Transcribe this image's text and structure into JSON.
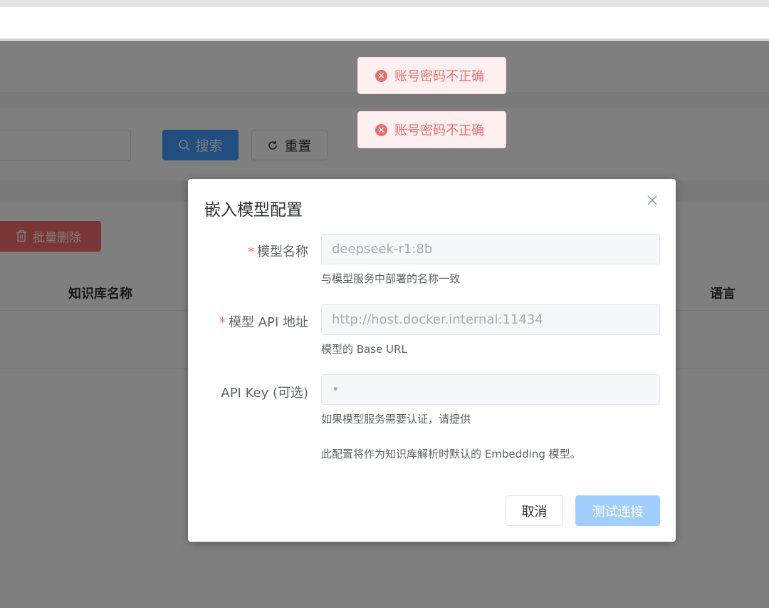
{
  "toolbar": {
    "search_label": "搜索",
    "reset_label": "重置",
    "batch_delete_label": "批量删除"
  },
  "table": {
    "columns": [
      "知识库名称",
      "语言"
    ]
  },
  "toasts": [
    "账号密码不正确",
    "账号密码不正确"
  ],
  "dialog": {
    "title": "嵌入模型配置",
    "fields": [
      {
        "label": "模型名称",
        "required": true,
        "value": "deepseek-r1:8b",
        "hint": "与模型服务中部署的名称一致"
      },
      {
        "label": "模型 API 地址",
        "required": true,
        "value": "http://host.docker.internal:11434",
        "hint": "模型的 Base URL"
      },
      {
        "label": "API Key (可选)",
        "required": false,
        "value": "•",
        "hint": "如果模型服务需要认证，请提供"
      }
    ],
    "note": "此配置将作为知识库解析时默认的 Embedding 模型。",
    "cancel_label": "取消",
    "test_label": "测试连接"
  },
  "colors": {
    "primary": "#409eff",
    "danger": "#f56c6c",
    "primary_disabled": "#a0cfff"
  }
}
